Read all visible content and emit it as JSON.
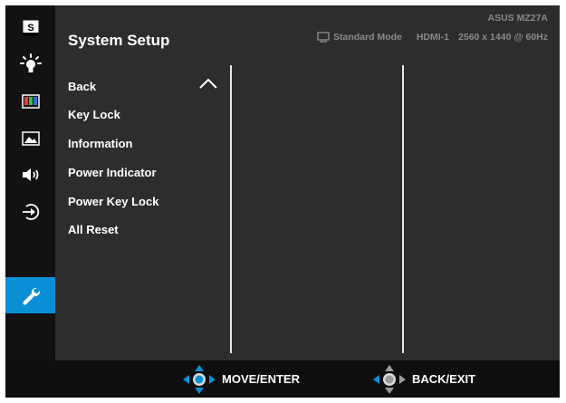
{
  "header": {
    "title": "System Setup",
    "model": "ASUS MZ27A",
    "mode": "Standard Mode",
    "input": "HDMI-1",
    "resolution": "2560 x 1440 @ 60Hz"
  },
  "sidebar": {
    "items": [
      {
        "name": "splendid",
        "icon": "splendid-s-icon",
        "glyph": "S"
      },
      {
        "name": "blue-light",
        "icon": "lightbulb-icon"
      },
      {
        "name": "color",
        "icon": "color-bars-icon"
      },
      {
        "name": "image",
        "icon": "image-icon"
      },
      {
        "name": "sound",
        "icon": "speaker-icon"
      },
      {
        "name": "input-select",
        "icon": "input-icon"
      },
      {
        "name": "system-setup",
        "icon": "wrench-icon",
        "active": true
      }
    ]
  },
  "menu": {
    "items": [
      "Back",
      "Key Lock",
      "Information",
      "Power Indicator",
      "Power Key Lock",
      "All Reset"
    ]
  },
  "footer": {
    "move_label": "MOVE/ENTER",
    "back_label": "BACK/EXIT"
  },
  "colors": {
    "accent": "#0a8fd6",
    "panel": "#2d2d2d",
    "sidebar": "#121212"
  }
}
